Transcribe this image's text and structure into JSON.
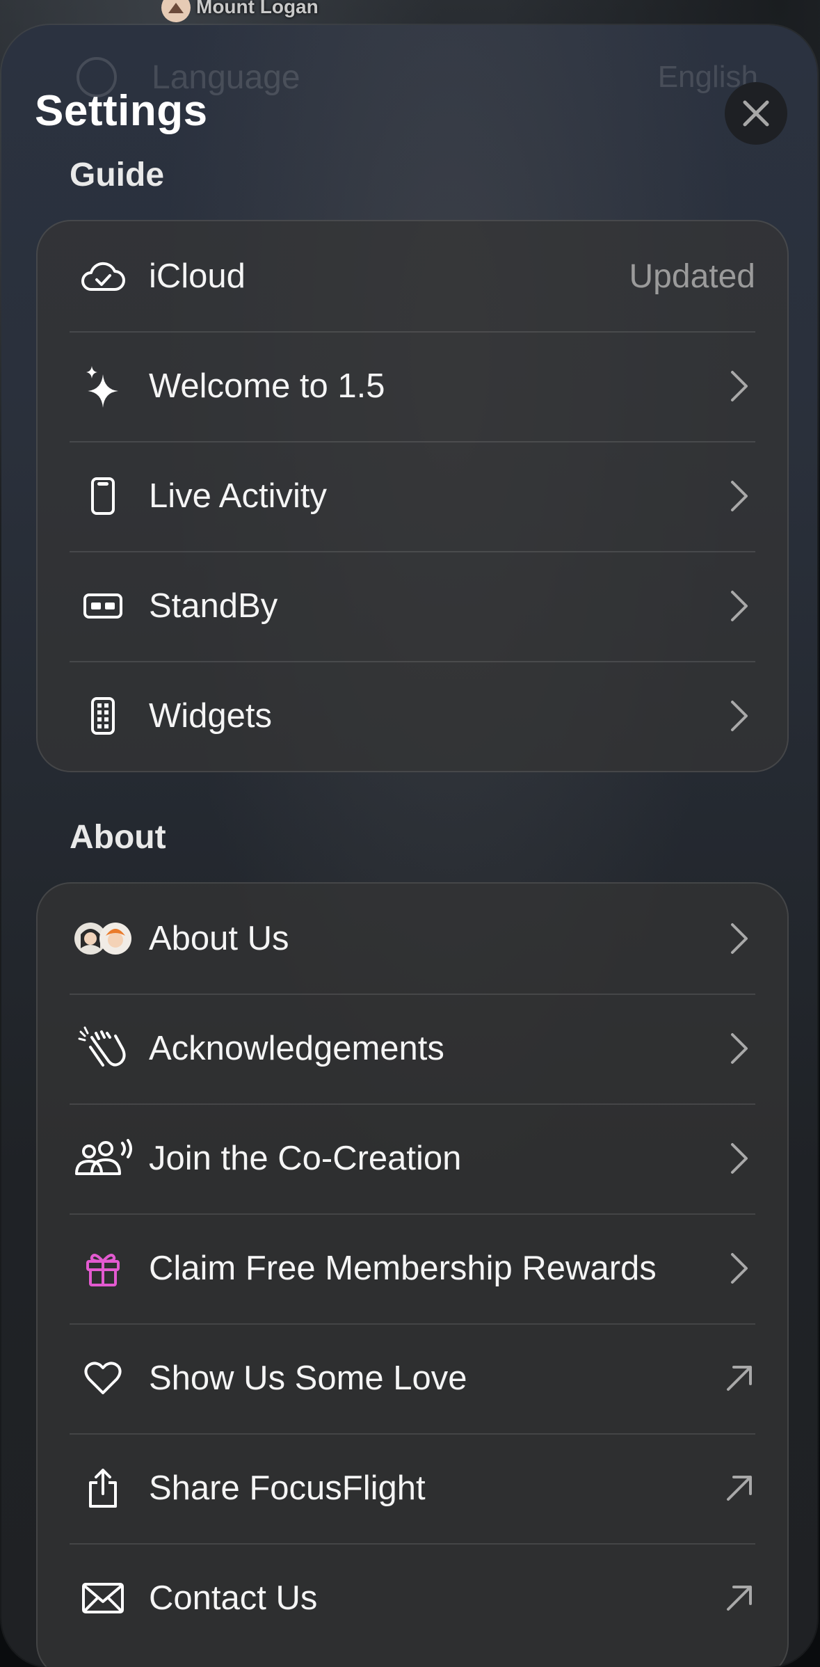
{
  "map": {
    "pin_label": "Mount Logan"
  },
  "background_row": {
    "label": "Language",
    "value": "English"
  },
  "title": "Settings",
  "sections": {
    "guide": {
      "header": "Guide",
      "items": [
        {
          "label": "iCloud",
          "icon": "cloud-check-icon",
          "value": "Updated"
        },
        {
          "label": "Welcome to 1.5",
          "icon": "sparkles-icon"
        },
        {
          "label": "Live Activity",
          "icon": "phone-icon"
        },
        {
          "label": "StandBy",
          "icon": "standby-icon"
        },
        {
          "label": "Widgets",
          "icon": "widgets-icon"
        }
      ]
    },
    "about": {
      "header": "About",
      "items": [
        {
          "label": "About Us",
          "icon": "avatars-icon"
        },
        {
          "label": "Acknowledgements",
          "icon": "clapping-hands-icon"
        },
        {
          "label": "Join the Co-Creation",
          "icon": "people-speaking-icon"
        },
        {
          "label": "Claim Free Membership Rewards",
          "icon": "gift-icon"
        },
        {
          "label": "Show Us Some Love",
          "icon": "heart-icon"
        },
        {
          "label": "Share FocusFlight",
          "icon": "share-icon"
        },
        {
          "label": "Contact Us",
          "icon": "envelope-icon"
        }
      ]
    }
  },
  "colors": {
    "gift_icon": "#e35ad0",
    "secondary_text": "#9b9b9b",
    "chevron": "#a9a9a9"
  }
}
